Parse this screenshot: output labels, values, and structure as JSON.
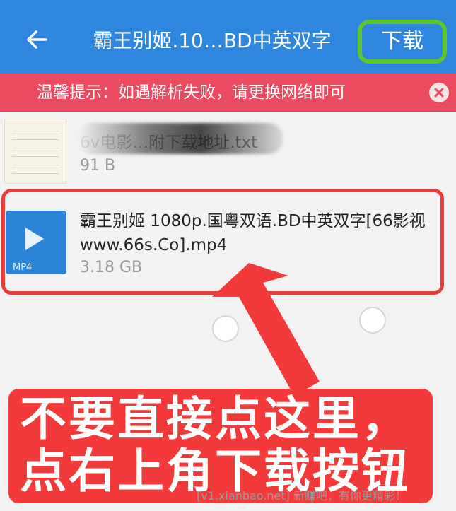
{
  "header": {
    "back_icon": "arrow-left-icon",
    "title": "霸王别姬.10…BD中英双字",
    "download_label": "下载"
  },
  "notice": {
    "text": "温馨提示：如遇解析失败，请更换网络即可",
    "close_icon": "close-icon"
  },
  "files": [
    {
      "icon": "text-file-icon",
      "name": "6v电影…附下载地址.txt",
      "size": "91 B"
    },
    {
      "icon": "video-file-icon",
      "type_label": "MP4",
      "name": "霸王别姬 1080p.国粤双语.BD中英双字[66影视www.66s.Co].mp4",
      "size": "3.18 GB"
    }
  ],
  "callout": {
    "line1": "不要直接点这里，",
    "line2": "点右上角下载按钮"
  },
  "watermark": "[v1.xianbao.net] 新赚吧，有你更精彩！",
  "colors": {
    "header_bg": "#2e86de",
    "notice_bg": "#ea4b61",
    "highlight_red": "#e83b3b",
    "download_outline": "#5cc62b"
  }
}
